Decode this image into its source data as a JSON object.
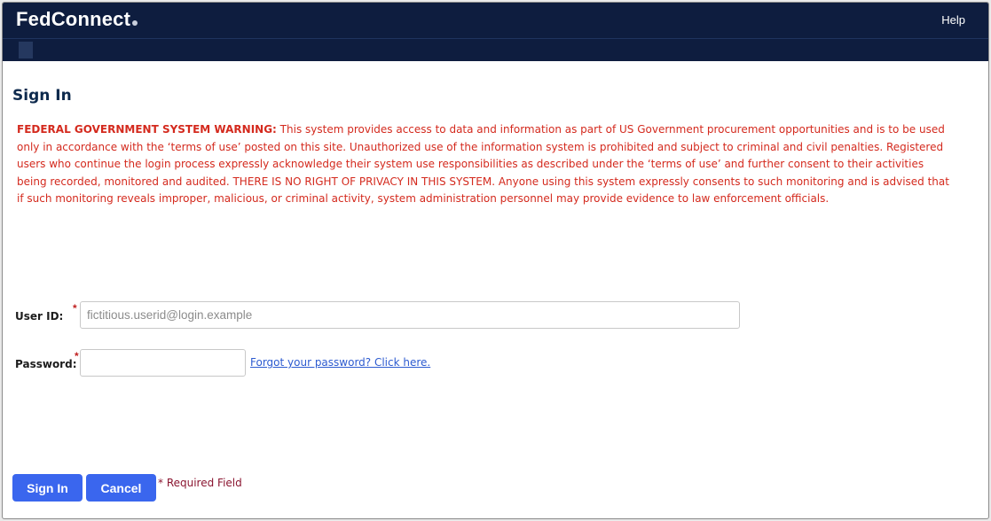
{
  "header": {
    "logo_text": "FedConnect",
    "help_label": "Help"
  },
  "page": {
    "title": "Sign In"
  },
  "warning": {
    "label": "FEDERAL GOVERNMENT SYSTEM WARNING:",
    "body": " This system provides access to data and information as part of US Government procurement opportunities and is to be used only in accordance with the ‘terms of use’ posted on this site. Unauthorized use of the information system is prohibited and subject to criminal and civil penalties. Registered users who continue the login process expressly acknowledge their system use responsibilities as described under the ‘terms of use’ and further consent to their activities being recorded, monitored and audited. THERE IS NO RIGHT OF PRIVACY IN THIS SYSTEM. Anyone using this system expressly consents to such monitoring and is advised that if such monitoring reveals improper, malicious, or criminal activity, system administration personnel may provide evidence to law enforcement officials.",
    "color": "#d42a1e"
  },
  "form": {
    "userid_label": "User ID:",
    "userid_placeholder": "fictitious.userid@login.example",
    "userid_value": "",
    "password_label": "Password:",
    "password_value": "",
    "required_marker": "*",
    "forgot_link": "Forgot your password? Click here."
  },
  "actions": {
    "signin_label": "Sign In",
    "cancel_label": "Cancel",
    "required_note": "* Required Field"
  },
  "colors": {
    "header_bg": "#0e1d3f",
    "button_bg": "#3a66ee",
    "link": "#2d5bd0",
    "required_star": "#c02020"
  }
}
